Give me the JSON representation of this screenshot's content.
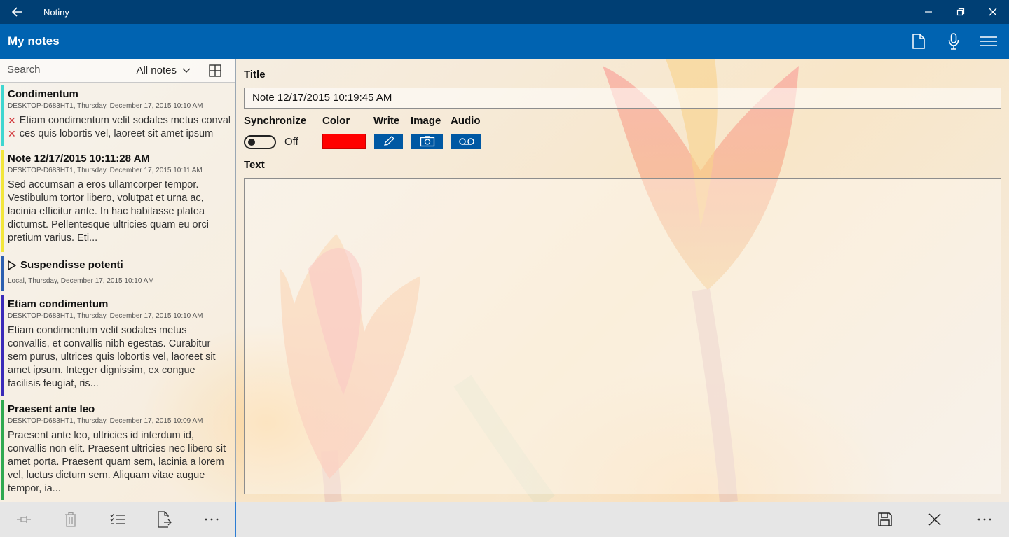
{
  "window": {
    "app_title": "Notiny",
    "back_icon": "back-arrow-icon",
    "controls": [
      "minimize-icon",
      "restore-icon",
      "close-icon"
    ]
  },
  "header": {
    "page_title": "My notes",
    "actions": [
      "new-note-icon",
      "microphone-icon",
      "hamburger-menu-icon"
    ]
  },
  "list": {
    "search_placeholder": "Search",
    "filter_label": "All notes",
    "notes": [
      {
        "title": "Condimentum",
        "meta": "DESKTOP-D683HT1, Thursday, December 17, 2015 10:10 AM",
        "color": "#3fd6d0",
        "checklist": [
          "Etiam condimentum velit sodales metus convallis",
          "ces quis lobortis vel, laoreet sit amet ipsum"
        ]
      },
      {
        "title": "Note 12/17/2015 10:11:28 AM",
        "meta": "DESKTOP-D683HT1, Thursday, December 17, 2015 10:11 AM",
        "color": "#f2e63a",
        "body": "Sed accumsan a eros ullamcorper tempor. Vestibulum tortor libero, volutpat et urna ac, lacinia efficitur ante. In hac habitasse platea dictumst. Pellentesque ultricies quam eu orci pretium varius. Eti..."
      },
      {
        "title": "Suspendisse potenti",
        "meta": "Local, Thursday, December 17, 2015 10:10 AM",
        "color": "#2c5fb0"
      },
      {
        "title": "Etiam condimentum",
        "meta": "DESKTOP-D683HT1, Thursday, December 17, 2015 10:10 AM",
        "color": "#3a2ab8",
        "body": "Etiam condimentum velit sodales metus convallis, et convallis nibh egestas. Curabitur sem purus, ultrices quis lobortis vel, laoreet sit amet ipsum. Integer dignissim, ex congue facilisis feugiat, ris..."
      },
      {
        "title": "Praesent ante leo",
        "meta": "DESKTOP-D683HT1, Thursday, December 17, 2015 10:09 AM",
        "color": "#2fa84f",
        "body": "Praesent ante leo, ultricies id interdum id, convallis non elit. Praesent ultricies nec libero sit amet porta. Praesent quam sem, lacinia a lorem vel, luctus dictum sem. Aliquam vitae augue tempor, ia..."
      }
    ]
  },
  "editor": {
    "title_label": "Title",
    "title_value": "Note 12/17/2015 10:19:45 AM",
    "sync_label": "Synchronize",
    "sync_state": "Off",
    "color_label": "Color",
    "color_value": "#ff0000",
    "write_label": "Write",
    "image_label": "Image",
    "audio_label": "Audio",
    "text_label": "Text",
    "text_value": ""
  },
  "commands": {
    "left": [
      "pin-icon",
      "delete-icon",
      "checklist-icon",
      "export-icon",
      "more-icon"
    ],
    "right": [
      "save-icon",
      "close-icon",
      "more-icon"
    ]
  }
}
